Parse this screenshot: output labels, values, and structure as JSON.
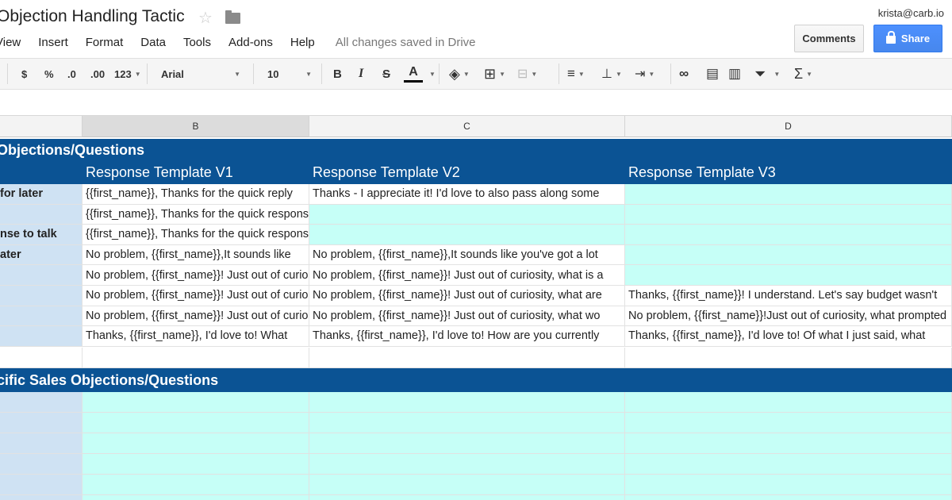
{
  "doc": {
    "title": "Objection Handling Tactic",
    "user_email": "krista@carb.io",
    "save_status": "All changes saved in Drive"
  },
  "menu": [
    "View",
    "Insert",
    "Format",
    "Data",
    "Tools",
    "Add-ons",
    "Help"
  ],
  "buttons": {
    "comments": "Comments",
    "share": "Share"
  },
  "toolbar": {
    "currency": "$",
    "percent": "%",
    "decrease_decimals": ".0",
    "increase_decimals": ".00",
    "more_formats": "123",
    "font": "Arial",
    "font_size": "10",
    "bold": "B",
    "italic": "I",
    "strikethrough": "S",
    "text_color": "A",
    "sum": "Σ"
  },
  "columns": [
    "B",
    "C",
    "D"
  ],
  "section1": {
    "title": "Objections/Questions",
    "headers": [
      "Response Template V1",
      "Response Template V2",
      "Response Template V3"
    ],
    "rows": [
      [
        "for later",
        "{{first_name}}, Thanks for the quick reply",
        "Thanks - I appreciate it! I'd love to also pass along some",
        ""
      ],
      [
        "",
        "{{first_name}}, Thanks for the quick response",
        "",
        ""
      ],
      [
        "nse to talk",
        "{{first_name}}, Thanks for the quick response",
        "",
        ""
      ],
      [
        "ater",
        "No problem, {{first_name}},It sounds like",
        "No problem, {{first_name}},It sounds like you've got a lot",
        ""
      ],
      [
        "",
        "No problem, {{first_name}}!  Just out of curiosity",
        "No problem, {{first_name}}!  Just out of curiosity, what is a",
        ""
      ],
      [
        "",
        "No problem, {{first_name}}! Just out of curiosity",
        "No problem, {{first_name}}! Just out of curiosity, what are",
        "Thanks, {{first_name}}!  I understand. Let's say budget wasn't"
      ],
      [
        "",
        "No problem, {{first_name}}! Just out of curiosity",
        "No problem, {{first_name}}! Just out of curiosity, what wo",
        "No problem, {{first_name}}!Just out of curiosity, what prompted"
      ],
      [
        "",
        "Thanks, {{first_name}}, I'd love to!  What",
        "Thanks, {{first_name}}, I'd love to!  How are you currently",
        "Thanks, {{first_name}}, I'd love to!  Of what I just said, what"
      ]
    ]
  },
  "section2": {
    "title": "cific Sales Objections/Questions"
  }
}
